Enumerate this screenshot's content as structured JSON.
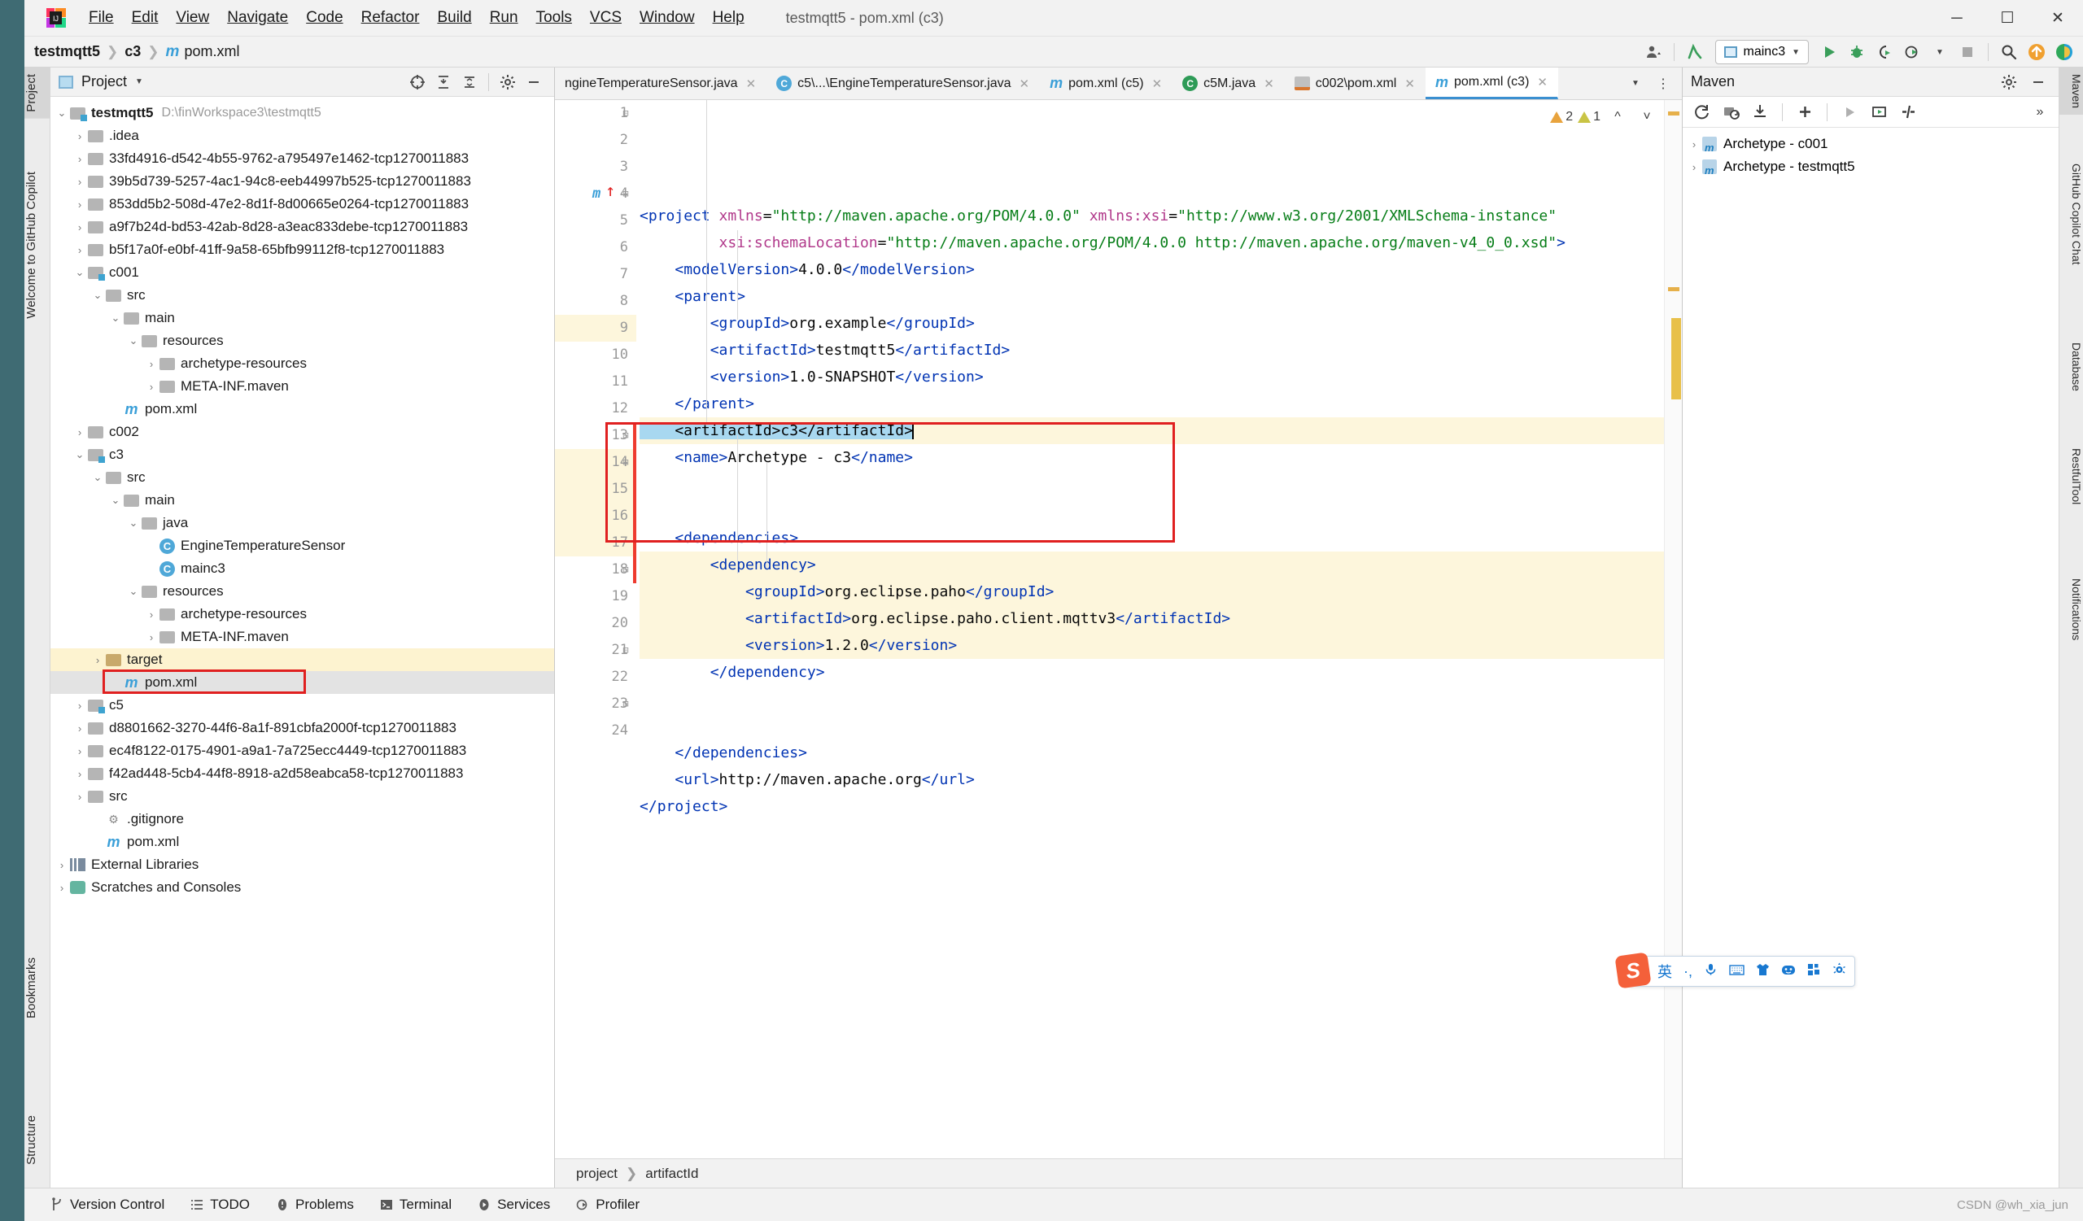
{
  "window": {
    "title": "testmqtt5 - pom.xml (c3)",
    "minimize": "─",
    "maximize": "☐",
    "close": "✕"
  },
  "menu": {
    "items": [
      "File",
      "Edit",
      "View",
      "Navigate",
      "Code",
      "Refactor",
      "Build",
      "Run",
      "Tools",
      "VCS",
      "Window",
      "Help"
    ]
  },
  "navbar": {
    "crumbs": [
      "testmqtt5",
      "c3",
      "pom.xml"
    ],
    "run_config": "mainc3",
    "icons": [
      "settings-sync-icon",
      "updates-icon",
      "search-everywhere-icon",
      "run-icon",
      "debug-icon",
      "run-coverage-icon",
      "profile-icon",
      "stop-icon"
    ]
  },
  "left_strip": {
    "labels": [
      "Project",
      "Welcome to GitHub Copilot",
      "Bookmarks",
      "Structure"
    ]
  },
  "right_strip": {
    "labels": [
      "Maven",
      "GitHub Copilot Chat",
      "Database",
      "RestfulTool",
      "Notifications"
    ]
  },
  "project_panel": {
    "title": "Project",
    "tree": [
      {
        "indent": 0,
        "arrow": "⌄",
        "icon": "module",
        "label": "testmqtt5",
        "bold": true,
        "path": "D:\\finWorkspace3\\testmqtt5"
      },
      {
        "indent": 1,
        "arrow": "›",
        "icon": "folder",
        "label": ".idea"
      },
      {
        "indent": 1,
        "arrow": "›",
        "icon": "folder",
        "label": "33fd4916-d542-4b55-9762-a795497e1462-tcp1270011883"
      },
      {
        "indent": 1,
        "arrow": "›",
        "icon": "folder",
        "label": "39b5d739-5257-4ac1-94c8-eeb44997b525-tcp1270011883"
      },
      {
        "indent": 1,
        "arrow": "›",
        "icon": "folder",
        "label": "853dd5b2-508d-47e2-8d1f-8d00665e0264-tcp1270011883"
      },
      {
        "indent": 1,
        "arrow": "›",
        "icon": "folder",
        "label": "a9f7b24d-bd53-42ab-8d28-a3eac833debe-tcp1270011883"
      },
      {
        "indent": 1,
        "arrow": "›",
        "icon": "folder",
        "label": "b5f17a0f-e0bf-41ff-9a58-65bfb99112f8-tcp1270011883"
      },
      {
        "indent": 1,
        "arrow": "⌄",
        "icon": "module",
        "label": "c001",
        "bold": false
      },
      {
        "indent": 2,
        "arrow": "⌄",
        "icon": "folder",
        "label": "src"
      },
      {
        "indent": 3,
        "arrow": "⌄",
        "icon": "folder",
        "label": "main"
      },
      {
        "indent": 4,
        "arrow": "⌄",
        "icon": "folder-res",
        "label": "resources"
      },
      {
        "indent": 5,
        "arrow": "›",
        "icon": "folder",
        "label": "archetype-resources"
      },
      {
        "indent": 5,
        "arrow": "›",
        "icon": "folder",
        "label": "META-INF.maven"
      },
      {
        "indent": 3,
        "arrow": "",
        "icon": "maven",
        "label": "pom.xml"
      },
      {
        "indent": 1,
        "arrow": "›",
        "icon": "folder",
        "label": "c002"
      },
      {
        "indent": 1,
        "arrow": "⌄",
        "icon": "module",
        "label": "c3",
        "bold": false
      },
      {
        "indent": 2,
        "arrow": "⌄",
        "icon": "folder",
        "label": "src"
      },
      {
        "indent": 3,
        "arrow": "⌄",
        "icon": "folder",
        "label": "main"
      },
      {
        "indent": 4,
        "arrow": "⌄",
        "icon": "folder",
        "label": "java"
      },
      {
        "indent": 5,
        "arrow": "",
        "icon": "java",
        "label": "EngineTemperatureSensor"
      },
      {
        "indent": 5,
        "arrow": "",
        "icon": "java",
        "label": "mainc3"
      },
      {
        "indent": 4,
        "arrow": "⌄",
        "icon": "folder-res",
        "label": "resources"
      },
      {
        "indent": 5,
        "arrow": "›",
        "icon": "folder",
        "label": "archetype-resources"
      },
      {
        "indent": 5,
        "arrow": "›",
        "icon": "folder",
        "label": "META-INF.maven"
      },
      {
        "indent": 2,
        "arrow": "›",
        "icon": "folder-target",
        "label": "target",
        "rowstyle": "sel-yellow"
      },
      {
        "indent": 3,
        "arrow": "",
        "icon": "maven",
        "label": "pom.xml",
        "rowstyle": "sel-gray",
        "highlight_box": true
      },
      {
        "indent": 1,
        "arrow": "›",
        "icon": "module",
        "label": "c5",
        "bold": false
      },
      {
        "indent": 1,
        "arrow": "›",
        "icon": "folder",
        "label": "d8801662-3270-44f6-8a1f-891cbfa2000f-tcp1270011883"
      },
      {
        "indent": 1,
        "arrow": "›",
        "icon": "folder",
        "label": "ec4f8122-0175-4901-a9a1-7a725ecc4449-tcp1270011883"
      },
      {
        "indent": 1,
        "arrow": "›",
        "icon": "folder",
        "label": "f42ad448-5cb4-44f8-8918-a2d58eabca58-tcp1270011883"
      },
      {
        "indent": 1,
        "arrow": "›",
        "icon": "folder",
        "label": "src"
      },
      {
        "indent": 2,
        "arrow": "",
        "icon": "git",
        "label": ".gitignore"
      },
      {
        "indent": 2,
        "arrow": "",
        "icon": "maven",
        "label": "pom.xml"
      },
      {
        "indent": 0,
        "arrow": "›",
        "icon": "library",
        "label": "External Libraries"
      },
      {
        "indent": 0,
        "arrow": "›",
        "icon": "scratch",
        "label": "Scratches and Consoles"
      }
    ]
  },
  "editor": {
    "tabs": [
      {
        "label": "ngineTemperatureSensor.java",
        "icon": "java-icon",
        "active": false,
        "closable": true
      },
      {
        "label": "c5\\...\\EngineTemperatureSensor.java",
        "icon": "java-icon",
        "active": false,
        "closable": true
      },
      {
        "label": "pom.xml (c5)",
        "icon": "maven-icon",
        "active": false,
        "closable": true
      },
      {
        "label": "c5M.java",
        "icon": "java-run-icon",
        "active": false,
        "closable": true
      },
      {
        "label": "c002\\pom.xml",
        "icon": "xml-icon",
        "active": false,
        "closable": true
      },
      {
        "label": "pom.xml (c3)",
        "icon": "maven-icon",
        "active": true,
        "closable": true
      }
    ],
    "inspections": {
      "warnings": "2",
      "weak_warnings": "1"
    },
    "lines": [
      {
        "n": 1,
        "fold": "⊟",
        "segs": [
          {
            "t": "<",
            "c": "tag"
          },
          {
            "t": "project",
            "c": "tagname"
          },
          {
            "t": " ",
            "c": "txt"
          },
          {
            "t": "xmlns",
            "c": "attr"
          },
          {
            "t": "=",
            "c": "txt"
          },
          {
            "t": "\"http://maven.apache.org/POM/4.0.0\"",
            "c": "val"
          },
          {
            "t": " ",
            "c": "txt"
          },
          {
            "t": "xmlns:xsi",
            "c": "attr"
          },
          {
            "t": "=",
            "c": "txt"
          },
          {
            "t": "\"http://www.w3.org/2001/XMLSchema-instance\"",
            "c": "val"
          }
        ]
      },
      {
        "n": 2,
        "fold": "",
        "segs": [
          {
            "t": "         ",
            "c": "txt"
          },
          {
            "t": "xsi:schemaLocation",
            "c": "attr"
          },
          {
            "t": "=",
            "c": "txt"
          },
          {
            "t": "\"http://maven.apache.org/POM/4.0.0 http://maven.apache.org/maven-v4_0_0.xsd\"",
            "c": "val"
          },
          {
            "t": ">",
            "c": "tag"
          }
        ]
      },
      {
        "n": 3,
        "fold": "",
        "segs": [
          {
            "t": "    <",
            "c": "tag"
          },
          {
            "t": "modelVersion",
            "c": "tagname"
          },
          {
            "t": ">",
            "c": "tag"
          },
          {
            "t": "4.0.0",
            "c": "txt"
          },
          {
            "t": "</",
            "c": "tag"
          },
          {
            "t": "modelVersion",
            "c": "tagname"
          },
          {
            "t": ">",
            "c": "tag"
          }
        ]
      },
      {
        "n": 4,
        "fold": "⊟",
        "gutter_icon": "maven-marker",
        "segs": [
          {
            "t": "    <",
            "c": "tag"
          },
          {
            "t": "parent",
            "c": "tagname"
          },
          {
            "t": ">",
            "c": "tag"
          }
        ]
      },
      {
        "n": 5,
        "fold": "",
        "segs": [
          {
            "t": "        <",
            "c": "tag"
          },
          {
            "t": "groupId",
            "c": "tagname"
          },
          {
            "t": ">",
            "c": "tag"
          },
          {
            "t": "org.example",
            "c": "txt"
          },
          {
            "t": "</",
            "c": "tag"
          },
          {
            "t": "groupId",
            "c": "tagname"
          },
          {
            "t": ">",
            "c": "tag"
          }
        ]
      },
      {
        "n": 6,
        "fold": "",
        "segs": [
          {
            "t": "        <",
            "c": "tag"
          },
          {
            "t": "artifactId",
            "c": "tagname"
          },
          {
            "t": ">",
            "c": "tag"
          },
          {
            "t": "testmqtt5",
            "c": "txt"
          },
          {
            "t": "</",
            "c": "tag"
          },
          {
            "t": "artifactId",
            "c": "tagname"
          },
          {
            "t": ">",
            "c": "tag"
          }
        ]
      },
      {
        "n": 7,
        "fold": "",
        "segs": [
          {
            "t": "        <",
            "c": "tag"
          },
          {
            "t": "version",
            "c": "tagname"
          },
          {
            "t": ">",
            "c": "tag"
          },
          {
            "t": "1.0-SNAPSHOT",
            "c": "txt"
          },
          {
            "t": "</",
            "c": "tag"
          },
          {
            "t": "version",
            "c": "tagname"
          },
          {
            "t": ">",
            "c": "tag"
          }
        ]
      },
      {
        "n": 8,
        "fold": "",
        "segs": [
          {
            "t": "    </",
            "c": "tag"
          },
          {
            "t": "parent",
            "c": "tagname"
          },
          {
            "t": ">",
            "c": "tag"
          }
        ]
      },
      {
        "n": 9,
        "fold": "",
        "hl": true,
        "selected": true,
        "segs": [
          {
            "t": "    <artifactId>c3</artifactId>",
            "c": "sel"
          }
        ]
      },
      {
        "n": 10,
        "fold": "",
        "segs": [
          {
            "t": "    <",
            "c": "tag"
          },
          {
            "t": "name",
            "c": "tagname"
          },
          {
            "t": ">",
            "c": "tag"
          },
          {
            "t": "Archetype - c3",
            "c": "txt"
          },
          {
            "t": "</",
            "c": "tag"
          },
          {
            "t": "name",
            "c": "tagname"
          },
          {
            "t": ">",
            "c": "tag"
          }
        ]
      },
      {
        "n": 11,
        "fold": "",
        "segs": []
      },
      {
        "n": 12,
        "fold": "",
        "segs": []
      },
      {
        "n": 13,
        "fold": "⊟",
        "segs": [
          {
            "t": "    <",
            "c": "tag"
          },
          {
            "t": "dependencies",
            "c": "tagname"
          },
          {
            "t": ">",
            "c": "tag"
          }
        ]
      },
      {
        "n": 14,
        "fold": "⊟",
        "hl": true,
        "segs": [
          {
            "t": "        <",
            "c": "tag"
          },
          {
            "t": "dependency",
            "c": "tagname"
          },
          {
            "t": ">",
            "c": "tag"
          }
        ]
      },
      {
        "n": 15,
        "fold": "",
        "hl": true,
        "segs": [
          {
            "t": "            <",
            "c": "tag"
          },
          {
            "t": "groupId",
            "c": "tagname"
          },
          {
            "t": ">",
            "c": "tag"
          },
          {
            "t": "org.eclipse.paho",
            "c": "txt"
          },
          {
            "t": "</",
            "c": "tag"
          },
          {
            "t": "groupId",
            "c": "tagname"
          },
          {
            "t": ">",
            "c": "tag"
          }
        ]
      },
      {
        "n": 16,
        "fold": "",
        "hl": true,
        "segs": [
          {
            "t": "            <",
            "c": "tag"
          },
          {
            "t": "artifactId",
            "c": "tagname"
          },
          {
            "t": ">",
            "c": "tag"
          },
          {
            "t": "org.eclipse.paho.client.mqttv3",
            "c": "txt"
          },
          {
            "t": "</",
            "c": "tag"
          },
          {
            "t": "artifactId",
            "c": "tagname"
          },
          {
            "t": ">",
            "c": "tag"
          }
        ]
      },
      {
        "n": 17,
        "fold": "",
        "hl": true,
        "segs": [
          {
            "t": "            <",
            "c": "tag"
          },
          {
            "t": "version",
            "c": "tagname"
          },
          {
            "t": ">",
            "c": "tag"
          },
          {
            "t": "1.2.0",
            "c": "txt"
          },
          {
            "t": "</",
            "c": "tag"
          },
          {
            "t": "version",
            "c": "tagname"
          },
          {
            "t": ">",
            "c": "tag"
          }
        ]
      },
      {
        "n": 18,
        "fold": "⊟",
        "segs": [
          {
            "t": "        </",
            "c": "tag"
          },
          {
            "t": "dependency",
            "c": "tagname"
          },
          {
            "t": ">",
            "c": "tag"
          }
        ]
      },
      {
        "n": 19,
        "fold": "",
        "segs": []
      },
      {
        "n": 20,
        "fold": "",
        "segs": []
      },
      {
        "n": 21,
        "fold": "⊟",
        "segs": [
          {
            "t": "    </",
            "c": "tag"
          },
          {
            "t": "dependencies",
            "c": "tagname"
          },
          {
            "t": ">",
            "c": "tag"
          }
        ]
      },
      {
        "n": 22,
        "fold": "",
        "segs": [
          {
            "t": "    <",
            "c": "tag"
          },
          {
            "t": "url",
            "c": "tagname"
          },
          {
            "t": ">",
            "c": "tag"
          },
          {
            "t": "http://maven.apache.org",
            "c": "txt"
          },
          {
            "t": "</",
            "c": "tag"
          },
          {
            "t": "url",
            "c": "tagname"
          },
          {
            "t": ">",
            "c": "tag"
          }
        ]
      },
      {
        "n": 23,
        "fold": "⊞",
        "segs": [
          {
            "t": "</",
            "c": "tag"
          },
          {
            "t": "project",
            "c": "tagname"
          },
          {
            "t": ">",
            "c": "tag"
          }
        ]
      },
      {
        "n": 24,
        "fold": "",
        "segs": []
      }
    ],
    "bottom_breadcrumb": [
      "project",
      "artifactId"
    ]
  },
  "maven_panel": {
    "title": "Maven",
    "tree": [
      {
        "label": "Archetype - c001"
      },
      {
        "label": "Archetype - testmqtt5"
      }
    ],
    "toolbar_icons": [
      "reload-icon",
      "add-maven-project-icon",
      "download-sources-icon",
      "add-icon",
      "run-icon",
      "execute-goal-icon",
      "toggle-offline-icon",
      "more-icon"
    ]
  },
  "statusbar": {
    "items": [
      {
        "label": "Version Control",
        "icon": "branch-icon"
      },
      {
        "label": "TODO",
        "icon": "list-icon"
      },
      {
        "label": "Problems",
        "icon": "error-icon"
      },
      {
        "label": "Terminal",
        "icon": "terminal-icon"
      },
      {
        "label": "Services",
        "icon": "services-icon"
      },
      {
        "label": "Profiler",
        "icon": "profiler-icon"
      }
    ],
    "watermark": "CSDN @wh_xia_jun"
  },
  "ime": {
    "mode": "英",
    "icons": [
      "punctuation-icon",
      "microphone-icon",
      "keyboard-icon",
      "skin-icon",
      "emoji-icon",
      "apps-icon",
      "settings-icon"
    ]
  },
  "colors": {
    "accent": "#3a8fd0",
    "highlight_box": "#e02020",
    "selection": "#a8d8f0",
    "code_highlight": "#fdf6dc"
  }
}
